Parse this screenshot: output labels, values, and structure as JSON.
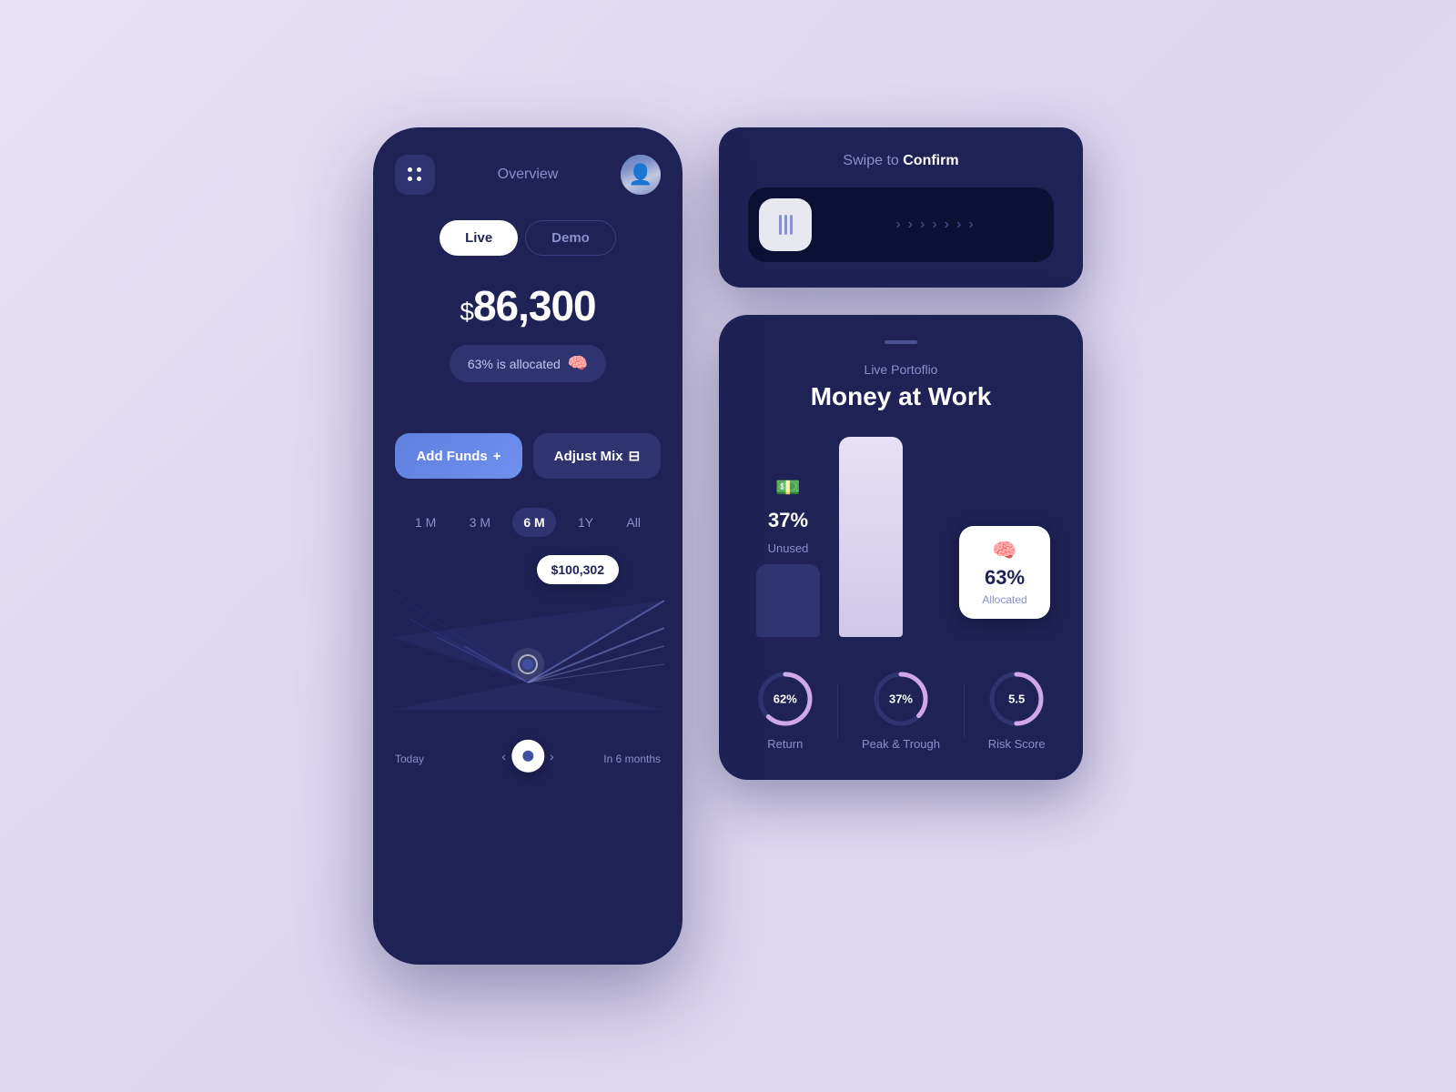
{
  "app": {
    "title": "Overview"
  },
  "left_phone": {
    "menu_label": "menu",
    "title": "Overview",
    "toggle": {
      "live_label": "Live",
      "demo_label": "Demo",
      "active": "Live"
    },
    "balance": {
      "currency_symbol": "$",
      "amount": "86,300"
    },
    "allocated_badge": "63% is allocated",
    "add_funds_label": "Add Funds",
    "adjust_mix_label": "Adjust Mix",
    "time_filters": [
      "1 M",
      "3 M",
      "6 M",
      "1Y",
      "All"
    ],
    "active_filter": "6 M",
    "chart_tooltip": "$100,302",
    "chart_label_left": "Today",
    "chart_label_right": "In 6 months"
  },
  "swipe_card": {
    "title_plain": "Swipe to ",
    "title_bold": "Confirm",
    "arrows": [
      "›",
      "›",
      "›",
      "›",
      "›",
      "›",
      "›"
    ]
  },
  "portfolio_card": {
    "subtitle": "Live Portoflio",
    "title": "Money at Work",
    "unused": {
      "percent": "37%",
      "label": "Unused",
      "emoji": "💵"
    },
    "allocated": {
      "percent": "63%",
      "label": "Allocated",
      "emoji": "🧠"
    },
    "stats": [
      {
        "label": "Return",
        "value": "62%",
        "progress": 62,
        "color": "#d0a8e8"
      },
      {
        "label": "Peak & Trough",
        "value": "37%",
        "progress": 37,
        "color": "#d0a8e8"
      },
      {
        "label": "Risk Score",
        "value": "5.5",
        "progress": 55,
        "color": "#d0a8e8"
      }
    ]
  },
  "colors": {
    "background": "#e8e0f5",
    "card_bg": "#1e2255",
    "accent_blue": "#6080e0",
    "accent_light": "#d0a8e8",
    "text_muted": "#8891cc",
    "text_white": "#ffffff"
  }
}
